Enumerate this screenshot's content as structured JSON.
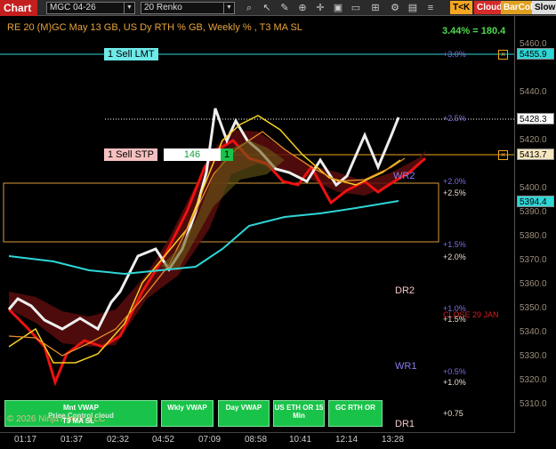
{
  "toolbar": {
    "chart_tab": "Chart",
    "instrument": "MGC 04-26",
    "period": "20 Renko",
    "icons": [
      "search-icon",
      "pointer-icon",
      "pencil-icon",
      "zoom-in-icon",
      "crosshair-icon",
      "tile-icon",
      "folder-icon",
      "grid-icon",
      "settings-icon"
    ],
    "tk": "T<K",
    "cloud": "Cloud",
    "barcol": "BarCol",
    "slowm": "SlowM"
  },
  "header": {
    "title": "RE 20  (M)GC May 13 GB, US Dy RTH % GB, Weekly % , T3 MA SL",
    "performance": "3.44% = 180.4"
  },
  "price_axis": {
    "ticks": [
      "5460.0",
      "5440.0",
      "5420.0",
      "5400.0",
      "5390.0",
      "5380.0",
      "5370.0",
      "5360.0",
      "5350.0",
      "5340.0",
      "5330.0",
      "5320.0",
      "5310.0"
    ],
    "labels": {
      "sell_lmt": "5455.9",
      "current": "5428.3",
      "sell_stp": "5413.7",
      "ma": "5394.4"
    }
  },
  "time_axis": [
    "01:17",
    "01:37",
    "02:32",
    "04:52",
    "07:09",
    "08:58",
    "10:41",
    "12:14",
    "13:28"
  ],
  "orders": {
    "sell_lmt": "1 Sell LMT",
    "sell_stp": "1 Sell STP",
    "stp_ticks": "146",
    "stp_qty": "1"
  },
  "annotations": {
    "pct_30": "+3.0%",
    "pct_25": "+2.5%",
    "pct_20": "+2.0%",
    "pct_25b": "+2.5%",
    "pct_15": "+1.5%",
    "pct_20b": "+2.0%",
    "pct_10": "+1.0%",
    "pct_15b": "+1.5%",
    "pct_05": "+0.5%",
    "pct_10b": "+1.0%",
    "pct_075": "+0.75",
    "wr2": "WR2",
    "dr2": "DR2",
    "close": "CLOSE 29 JAN",
    "wr1": "WR1",
    "dr1": "DR1"
  },
  "buttons": {
    "mnt_vwap": "Mnt VWAP",
    "price_overlay": "Price Control cloud",
    "copyright": "© 2026 NinjaTrader, LLC",
    "t3": "T3 MA SL",
    "wkly_vwap": "Wkly VWAP",
    "day_vwap": "Day VWAP",
    "us_eth": "US ETH OR 15 Min",
    "gc_rth": "GC RTH OR"
  },
  "colors": {
    "accent": "#c31f1f",
    "green": "#19c34a",
    "orange": "#e8a33a",
    "cyan": "#2fd6d6"
  }
}
